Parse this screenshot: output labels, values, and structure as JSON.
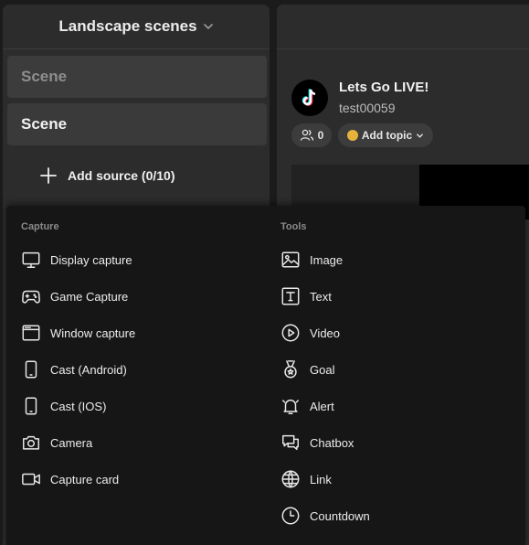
{
  "scenes": {
    "header_title": "Landscape scenes",
    "items": [
      "Scene",
      "Scene"
    ],
    "add_source_label": "Add source (0/10)"
  },
  "stream": {
    "title": "Lets Go LIVE!",
    "username": "test00059",
    "viewer_count": "0",
    "topic_label": "Add topic"
  },
  "source_menu": {
    "capture_label": "Capture",
    "tools_label": "Tools",
    "capture_items": [
      {
        "label": "Display capture",
        "icon": "monitor-icon"
      },
      {
        "label": "Game Capture",
        "icon": "gamepad-icon"
      },
      {
        "label": "Window capture",
        "icon": "window-icon"
      },
      {
        "label": "Cast (Android)",
        "icon": "phone-icon"
      },
      {
        "label": "Cast (IOS)",
        "icon": "phone-icon"
      },
      {
        "label": "Camera",
        "icon": "camera-icon"
      },
      {
        "label": "Capture card",
        "icon": "video-camera-icon"
      }
    ],
    "tool_items": [
      {
        "label": "Image",
        "icon": "image-icon"
      },
      {
        "label": "Text",
        "icon": "text-icon"
      },
      {
        "label": "Video",
        "icon": "play-circle-icon"
      },
      {
        "label": "Goal",
        "icon": "medal-icon"
      },
      {
        "label": "Alert",
        "icon": "bell-icon"
      },
      {
        "label": "Chatbox",
        "icon": "chat-icon"
      },
      {
        "label": "Link",
        "icon": "globe-icon"
      },
      {
        "label": "Countdown",
        "icon": "clock-icon"
      }
    ]
  },
  "colors": {
    "background": "#1b1b1b",
    "panel": "#2c2c2c",
    "menu": "#161616",
    "topic_accent": "#e7b23a"
  }
}
